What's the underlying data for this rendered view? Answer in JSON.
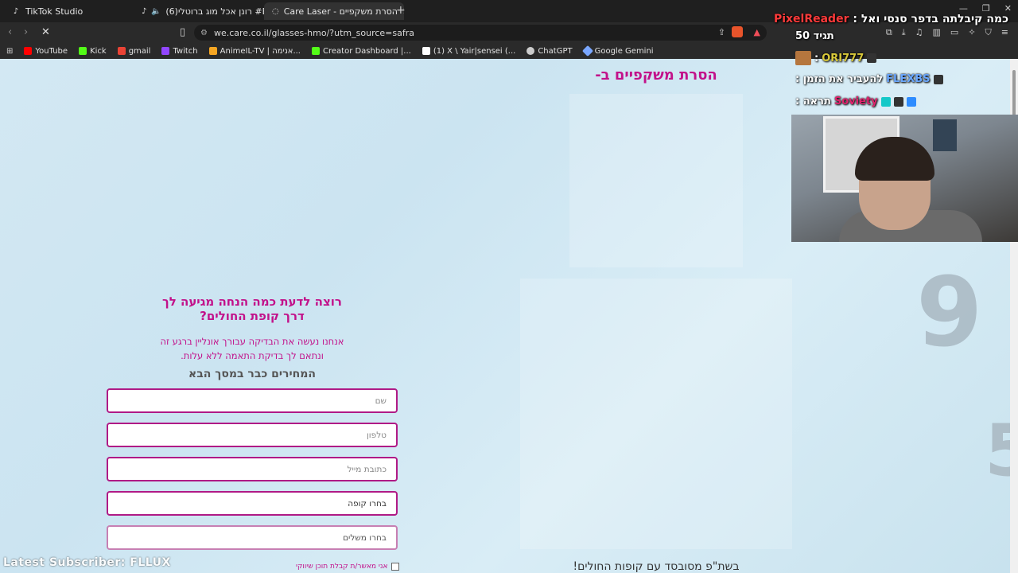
{
  "browser": {
    "tabs": [
      {
        "label": "TikTok Studio",
        "active": false
      },
      {
        "label": "(6)רונן אכל מוג ברוטלי #BP #רונג:",
        "active": false
      },
      {
        "label": "Care Laser - הסרת משקפיים",
        "active": true
      }
    ],
    "url": "we.care.co.il/glasses-hmo/?utm_source=safra",
    "bookmarks": [
      {
        "label": "YouTube",
        "color": "#ff0000"
      },
      {
        "label": "Kick",
        "color": "#53fc18"
      },
      {
        "label": "gmail",
        "color": "#ea4335"
      },
      {
        "label": "Twitch",
        "color": "#9146ff"
      },
      {
        "label": "AnimeIL-TV | אנימה...",
        "color": "#f5a623"
      },
      {
        "label": "Creator Dashboard |...",
        "color": "#53fc18"
      },
      {
        "label": "(1) X \\ Yair|sensei (...",
        "color": "#ffffff"
      },
      {
        "label": "ChatGPT",
        "color": "#cccccc"
      },
      {
        "label": "Google Gemini",
        "color": "#7aa7ff"
      }
    ]
  },
  "page": {
    "hero_title": "הסרת משקפיים ב-",
    "form": {
      "heading_line1": "רוצה לדעת כמה הנחה מגיעה לך",
      "heading_line2": "דרך קופת החולים?",
      "sub_line1": "אנחנו נעשה את הבדיקה עבורך אונליין ברגע זה",
      "sub_line2": "ונתאם לך בדיקת התאמה ללא עלות.",
      "prices_title": "המחירים כבר במסך הבא",
      "name_placeholder": "שם",
      "phone_placeholder": "טלפון",
      "email_placeholder": "כתובת מייל",
      "hmo_select": "בחרו קופה",
      "plan_select": "בחרו משלים",
      "consent_label": "אני מאשר/ת קבלת תוכן שיווקי"
    },
    "big_digit_1": "9",
    "big_digit_2": "5",
    "bottom_caption": "בשת\"פ מסובסד עם קופות החולים!"
  },
  "overlay": {
    "chat_title_text": "כמה קיבלתה בדפר סנסי ואל :",
    "chat_title_user": "PixelReader",
    "chat_subtitle": "תגיד 50",
    "chat_messages": [
      {
        "user": "ORI777",
        "text": ":",
        "color": "#d9c93a"
      },
      {
        "user": "FLEXBS",
        "text": "להעביר את הזמן :",
        "color": "#6aa7ff"
      },
      {
        "user": "Soviety",
        "text": "תראה :",
        "color": "#e0246e"
      }
    ],
    "latest_subscriber": "Latest Subscriber: FLLUX"
  }
}
